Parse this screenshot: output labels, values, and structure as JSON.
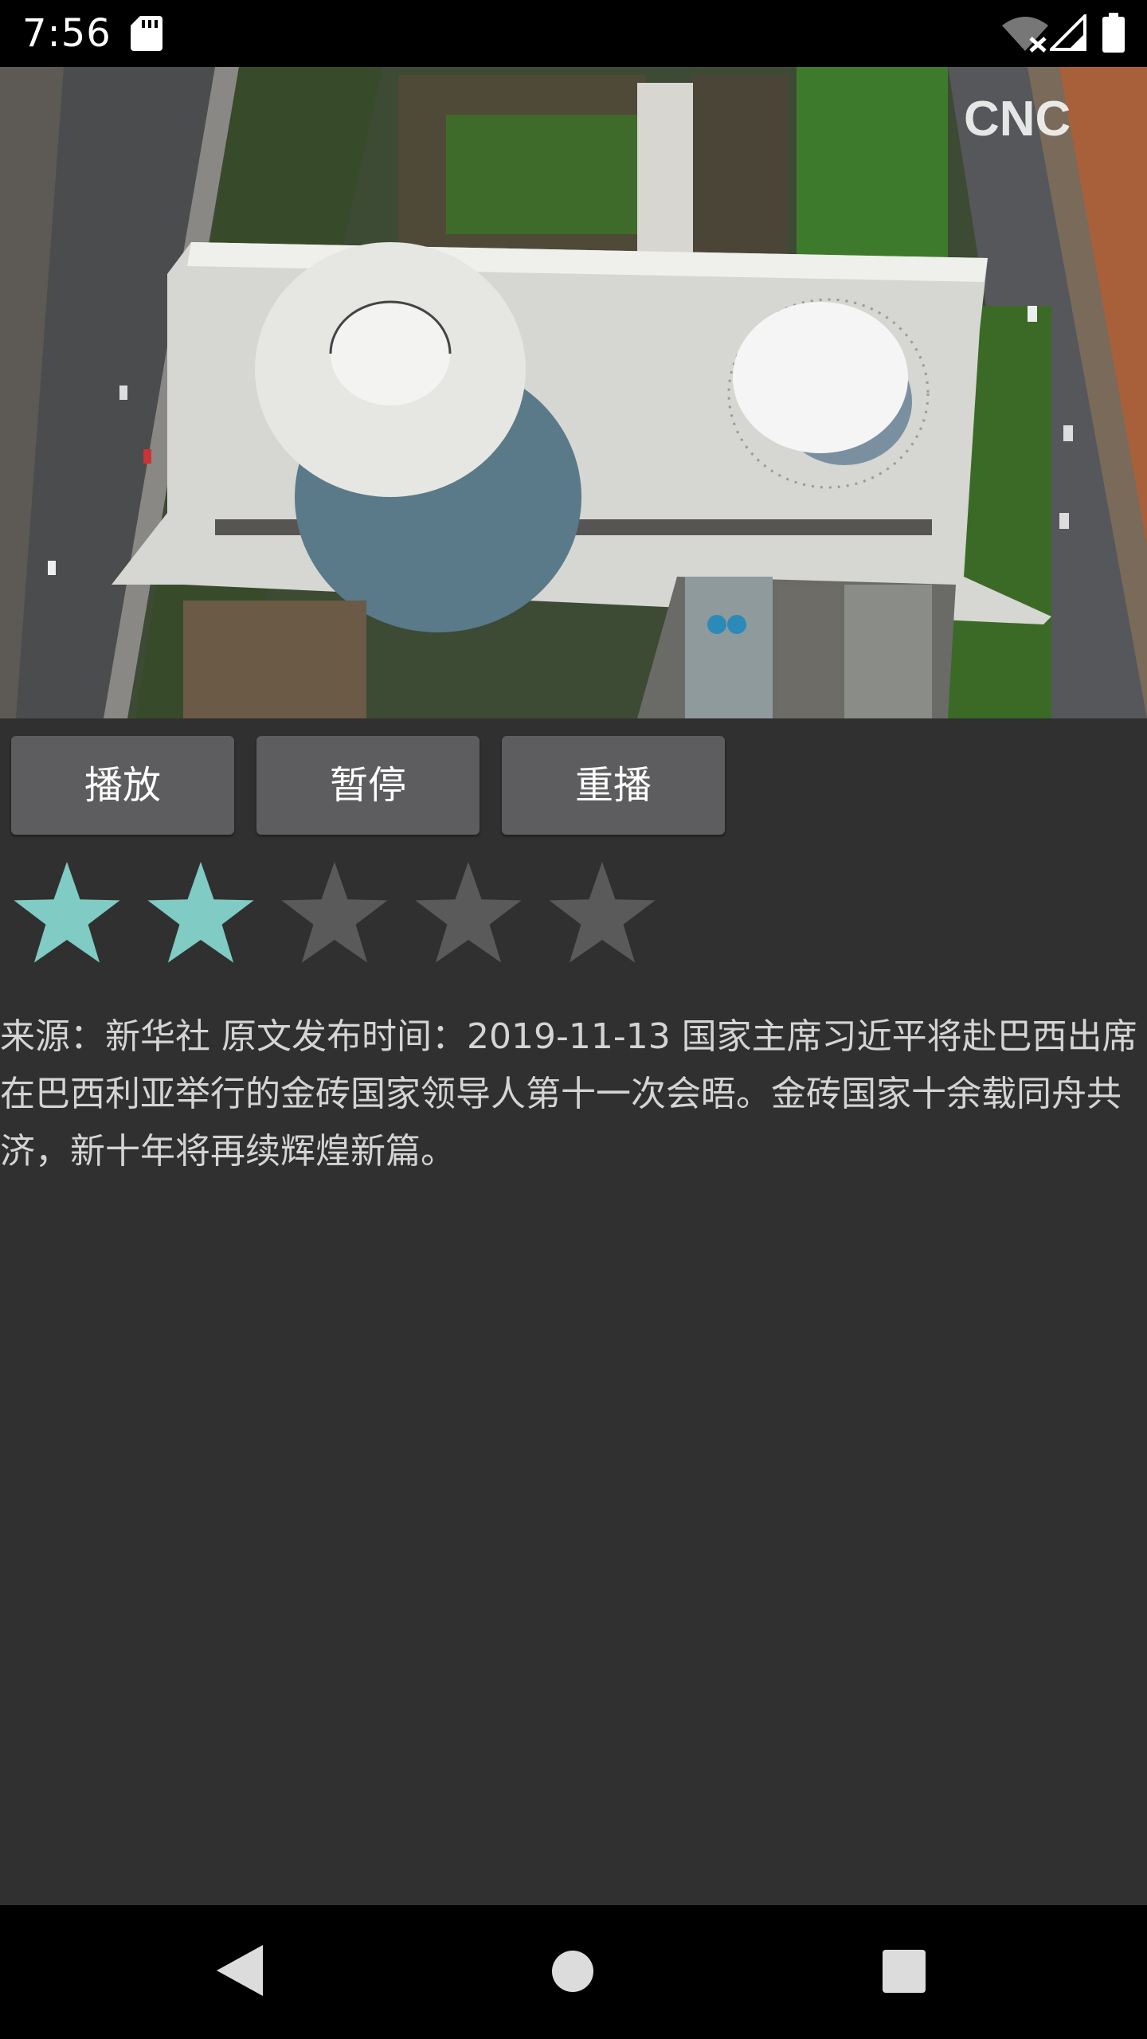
{
  "status_bar": {
    "time": "7:56",
    "icons": [
      "sd-card-icon",
      "wifi-off-icon",
      "cell-signal-icon",
      "battery-icon"
    ]
  },
  "video": {
    "watermark": "CNC",
    "content": "aerial-building-footage"
  },
  "controls": {
    "play_label": "播放",
    "pause_label": "暂停",
    "replay_label": "重播"
  },
  "rating": {
    "value": 2,
    "max": 5,
    "filled_color": "#80cbc4",
    "empty_color": "#5a5a5a"
  },
  "description": "来源：新华社 原文发布时间：2019-11-13 国家主席习近平将赴巴西出席在巴西利亚举行的金砖国家领导人第十一次会晤。金砖国家十余载同舟共济，新十年将再续辉煌新篇。",
  "nav_bar": {
    "icons": [
      "back-icon",
      "home-icon",
      "recents-icon"
    ]
  }
}
